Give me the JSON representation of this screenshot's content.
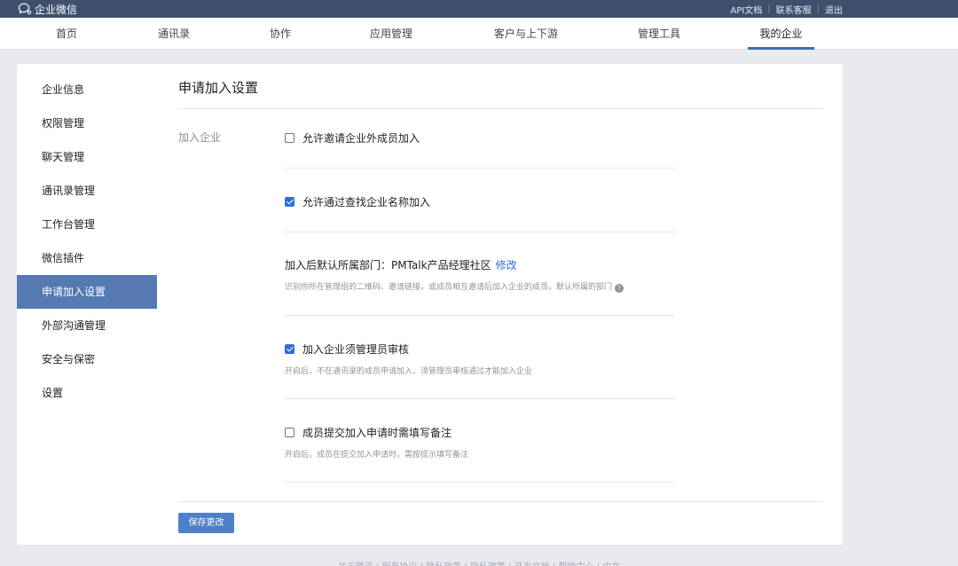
{
  "topbar": {
    "logo_text": "企业微信",
    "links": [
      "API文档",
      "联系客服",
      "退出"
    ]
  },
  "nav": {
    "items": [
      "首页",
      "通讯录",
      "协作",
      "应用管理",
      "客户与上下游",
      "管理工具",
      "我的企业"
    ],
    "active": "我的企业"
  },
  "sidebar": {
    "items": [
      "企业信息",
      "权限管理",
      "聊天管理",
      "通讯录管理",
      "工作台管理",
      "微信插件",
      "申请加入设置",
      "外部沟通管理",
      "安全与保密",
      "设置"
    ],
    "active": "申请加入设置"
  },
  "main": {
    "title": "申请加入设置",
    "field_label": "加入企业",
    "options": [
      {
        "label": "允许邀请企业外成员加入",
        "checked": false
      },
      {
        "label": "允许通过查找企业名称加入",
        "checked": true
      },
      {
        "label": "加入后默认所属部门：PMTalk产品经理社区",
        "link": "修改",
        "desc": "识别你所在管理组的二维码、邀请链接，或成员相互邀请后加入企业的成员，默认所属的部门"
      },
      {
        "label": "加入企业须管理员审核",
        "checked": true,
        "desc": "开启后，不在通讯录的成员申请加入，须管理员审核通过才能加入企业"
      },
      {
        "label": "成员提交加入申请时需填写备注",
        "checked": false,
        "desc": "开启后，成员在提交加入申请时，需按提示填写备注"
      }
    ],
    "save_label": "保存更改"
  },
  "footer": {
    "text": "关于腾讯 | 服务协议 | 隐私政策 | 隐私政策 | 开发文档 | 帮助中心 | 中文"
  },
  "colors": {
    "topbar": "#3f4f6e",
    "accent": "#557ab3",
    "checkbox": "#2f6fd6"
  }
}
